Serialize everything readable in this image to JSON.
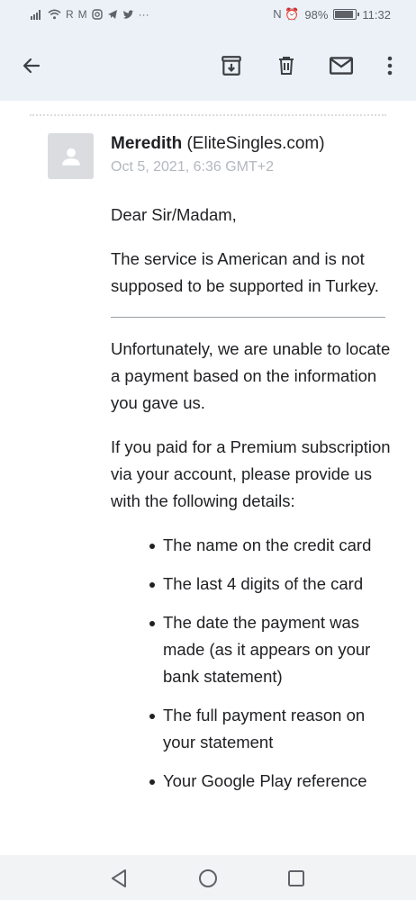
{
  "status_bar": {
    "left_icons": [
      "signal-icon",
      "wifi-icon",
      "app-icon-r",
      "gmail-icon",
      "instagram-icon",
      "telegram-icon",
      "twitter-icon",
      "more-icon"
    ],
    "nfc_alarm": "N ⏰",
    "battery_percent": "98%",
    "battery_level": 0.98,
    "time": "11:32"
  },
  "toolbar": {
    "back": "back-arrow-icon",
    "archive": "archive-icon",
    "delete": "delete-icon",
    "mark_unread": "mail-icon",
    "more": "more-vert-icon"
  },
  "email": {
    "sender_name": "Meredith",
    "sender_address": "(EliteSingles.com)",
    "timestamp": "Oct 5, 2021, 6:36 GMT+2",
    "greeting": "Dear Sir/Madam,",
    "paragraph_1": "The service is American and is not supposed to be supported in Turkey.",
    "paragraph_2": "Unfortunately, we are unable to locate a payment based on the information you gave us.",
    "paragraph_3": "If you paid for a Premium subscription via your account, please provide us with the following details:",
    "bullets": [
      "The name on the credit card",
      "The last 4 digits of the card",
      "The date the payment was made (as it appears on your bank statement)",
      "The full payment reason on your statement",
      "Your Google Play reference"
    ]
  },
  "nav_bar": {
    "back": "nav-back-icon",
    "home": "nav-home-icon",
    "recents": "nav-recents-icon"
  },
  "colors": {
    "toolbar_bg": "#ecf1f8",
    "text": "#202124",
    "muted": "#b3b8bf"
  }
}
